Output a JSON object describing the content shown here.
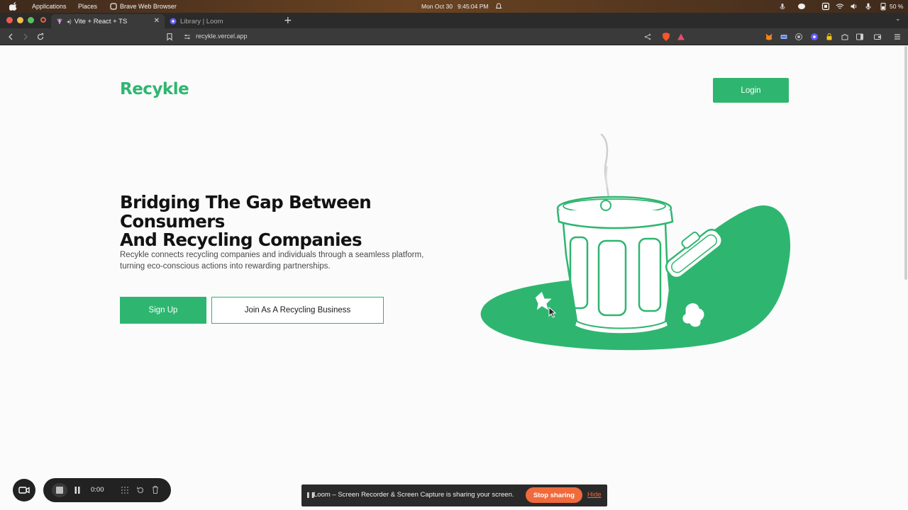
{
  "os": {
    "menus": [
      "Applications",
      "Places",
      "Brave Web Browser"
    ],
    "date": "Mon Oct 30",
    "time": "9:45:04 PM",
    "battery": "50 %"
  },
  "browser": {
    "tabs": [
      {
        "title": "Vite + React + TS",
        "active": true
      },
      {
        "title": "Library | Loom",
        "active": false
      }
    ],
    "new_tab": "+",
    "url": "recykle.vercel.app"
  },
  "page": {
    "logo": "Recykle",
    "login_label": "Login",
    "hero_title_line1": "Bridging The Gap Between Consumers",
    "hero_title_line2": "And Recycling Companies",
    "hero_desc_line1": "Recykle connects recycling companies and individuals through a seamless platform,",
    "hero_desc_line2": "turning eco-conscious actions into rewarding partnerships.",
    "signup_label": "Sign Up",
    "join_label": "Join As A Recycling Business"
  },
  "loom": {
    "timer": "0:00",
    "share_message": "Loom – Screen Recorder & Screen Capture is sharing your screen.",
    "stop_sharing": "Stop sharing",
    "hide": "Hide"
  },
  "colors": {
    "brand_green": "#2eb670",
    "loom_orange": "#f06a3c"
  }
}
